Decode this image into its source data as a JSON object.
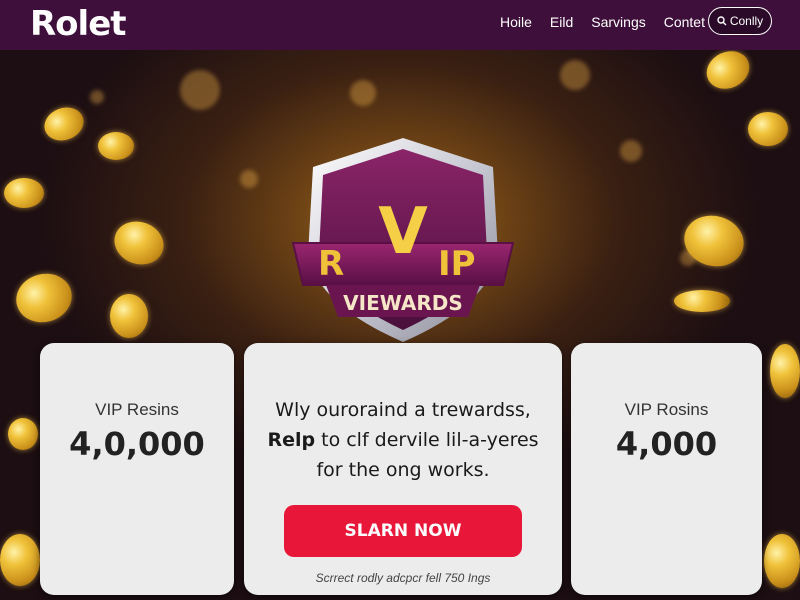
{
  "header": {
    "logo": "Rolet",
    "nav": [
      "Hoile",
      "Eild",
      "Sarvings",
      "Contet"
    ],
    "contact_icon": "search-icon",
    "contact_label": "Conlly"
  },
  "hero": {
    "badge_left": "R",
    "badge_v": "V",
    "badge_right": "IP",
    "badge_sub": "VIEWARDS"
  },
  "cards": {
    "left": {
      "label": "VIP Resins",
      "value": "4,0,000"
    },
    "right": {
      "label": "VIP Rosins",
      "value": "4,000"
    },
    "middle": {
      "line1": "Wly ouroraind a trewardss,",
      "line2_bold": "Relp",
      "line2_rest": " to clf dervile lil-a-yeres",
      "line3": "for the ong works.",
      "button": "SLARN NOW",
      "fine_print": "Scrrect rodly adcpcr fell 750 Ings"
    }
  },
  "colors": {
    "header_bg": "#3d0f3a",
    "cta": "#e8173a",
    "shield": "#7a1a5a",
    "gold": "#f0c23a"
  }
}
